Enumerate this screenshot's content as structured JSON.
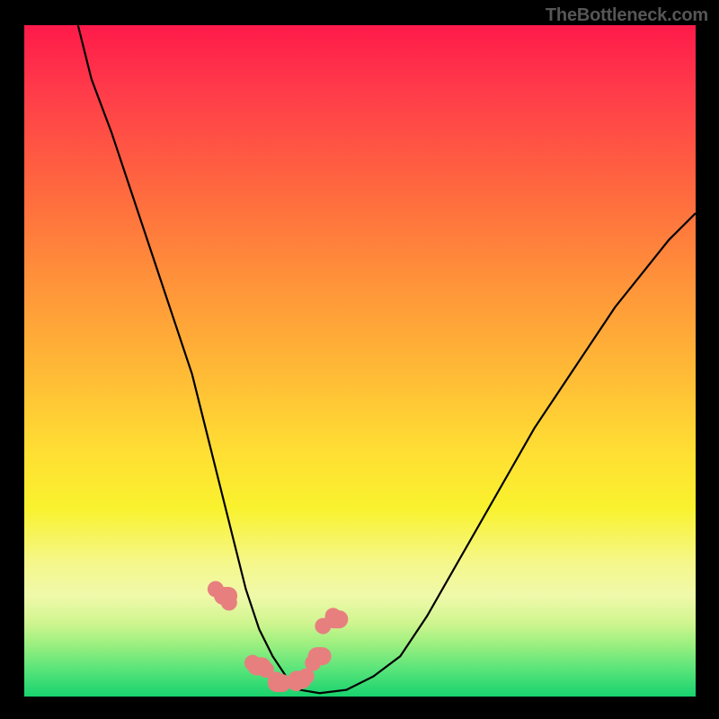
{
  "watermark": "TheBottleneck.com",
  "chart_data": {
    "type": "line",
    "title": "",
    "xlabel": "",
    "ylabel": "",
    "xlim": [
      0,
      100
    ],
    "ylim": [
      0,
      100
    ],
    "series": [
      {
        "name": "bottleneck-curve",
        "x": [
          8,
          10,
          13,
          16,
          19,
          22,
          25,
          27,
          29,
          31,
          33,
          35,
          37,
          39,
          41,
          44,
          48,
          52,
          56,
          60,
          64,
          68,
          72,
          76,
          80,
          84,
          88,
          92,
          96,
          100
        ],
        "values": [
          100,
          92,
          84,
          75,
          66,
          57,
          48,
          40,
          32,
          24,
          16,
          10,
          6,
          3,
          1,
          0.5,
          1,
          3,
          6,
          12,
          19,
          26,
          33,
          40,
          46,
          52,
          58,
          63,
          68,
          72
        ]
      },
      {
        "name": "highlight-markers",
        "x": [
          28.5,
          30.5,
          34,
          36,
          37.5,
          40.5,
          42,
          43,
          44.5,
          46
        ],
        "values": [
          16,
          14,
          5,
          4,
          2.5,
          2,
          3,
          5,
          10.5,
          12
        ]
      },
      {
        "name": "highlight-wide-markers",
        "x": [
          30,
          35,
          38,
          41,
          44,
          46.5
        ],
        "values": [
          15,
          4.5,
          2,
          2.5,
          6,
          11.5
        ]
      }
    ],
    "colors": {
      "curve": "#000000",
      "marker_fill": "#e77f7f",
      "marker_stroke": "#e77f7f"
    }
  }
}
